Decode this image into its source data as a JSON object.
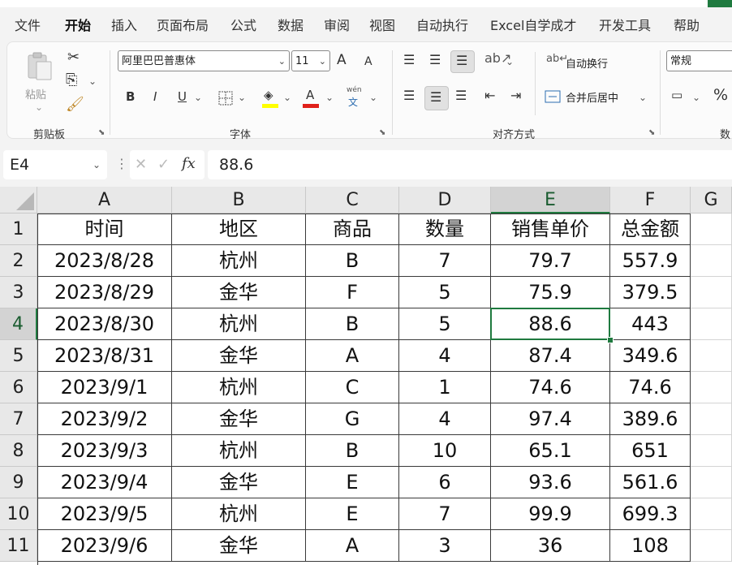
{
  "tabs": [
    "文件",
    "开始",
    "插入",
    "页面布局",
    "公式",
    "数据",
    "审阅",
    "视图",
    "自动执行",
    "Excel自学成才",
    "开发工具",
    "帮助"
  ],
  "active_tab": "开始",
  "ribbon": {
    "clipboard": {
      "label": "剪贴板",
      "paste_label": "粘贴"
    },
    "font": {
      "label": "字体",
      "font_name": "阿里巴巴普惠体",
      "font_size": "11",
      "bold": "B",
      "italic": "I",
      "underline": "U",
      "grow": "A",
      "shrink": "A",
      "phonetic": "wén"
    },
    "alignment": {
      "label": "对齐方式",
      "wrap_text": "自动换行",
      "merge_center": "合并后居中"
    },
    "number": {
      "label": "数",
      "format": "常规",
      "percent": "%"
    }
  },
  "formula_bar": {
    "name_box": "E4",
    "fx": "fx",
    "formula": "88.6"
  },
  "sheet": {
    "columns": [
      "A",
      "B",
      "C",
      "D",
      "E",
      "F",
      "G"
    ],
    "selected_column": "E",
    "selected_row": "4",
    "rows": [
      {
        "num": "1",
        "cells": [
          "时间",
          "地区",
          "商品",
          "数量",
          "销售单价",
          "总金额"
        ]
      },
      {
        "num": "2",
        "cells": [
          "2023/8/28",
          "杭州",
          "B",
          "7",
          "79.7",
          "557.9"
        ]
      },
      {
        "num": "3",
        "cells": [
          "2023/8/29",
          "金华",
          "F",
          "5",
          "75.9",
          "379.5"
        ]
      },
      {
        "num": "4",
        "cells": [
          "2023/8/30",
          "杭州",
          "B",
          "5",
          "88.6",
          "443"
        ]
      },
      {
        "num": "5",
        "cells": [
          "2023/8/31",
          "金华",
          "A",
          "4",
          "87.4",
          "349.6"
        ]
      },
      {
        "num": "6",
        "cells": [
          "2023/9/1",
          "杭州",
          "C",
          "1",
          "74.6",
          "74.6"
        ]
      },
      {
        "num": "7",
        "cells": [
          "2023/9/2",
          "金华",
          "G",
          "4",
          "97.4",
          "389.6"
        ]
      },
      {
        "num": "8",
        "cells": [
          "2023/9/3",
          "杭州",
          "B",
          "10",
          "65.1",
          "651"
        ]
      },
      {
        "num": "9",
        "cells": [
          "2023/9/4",
          "金华",
          "E",
          "6",
          "93.6",
          "561.6"
        ]
      },
      {
        "num": "10",
        "cells": [
          "2023/9/5",
          "杭州",
          "E",
          "7",
          "99.9",
          "699.3"
        ]
      },
      {
        "num": "11",
        "cells": [
          "2023/9/6",
          "金华",
          "A",
          "3",
          "36",
          "108"
        ]
      }
    ]
  },
  "colors": {
    "accent": "#1f7a3f",
    "font_color": "#e0201a",
    "fill_color": "#ffff00"
  }
}
